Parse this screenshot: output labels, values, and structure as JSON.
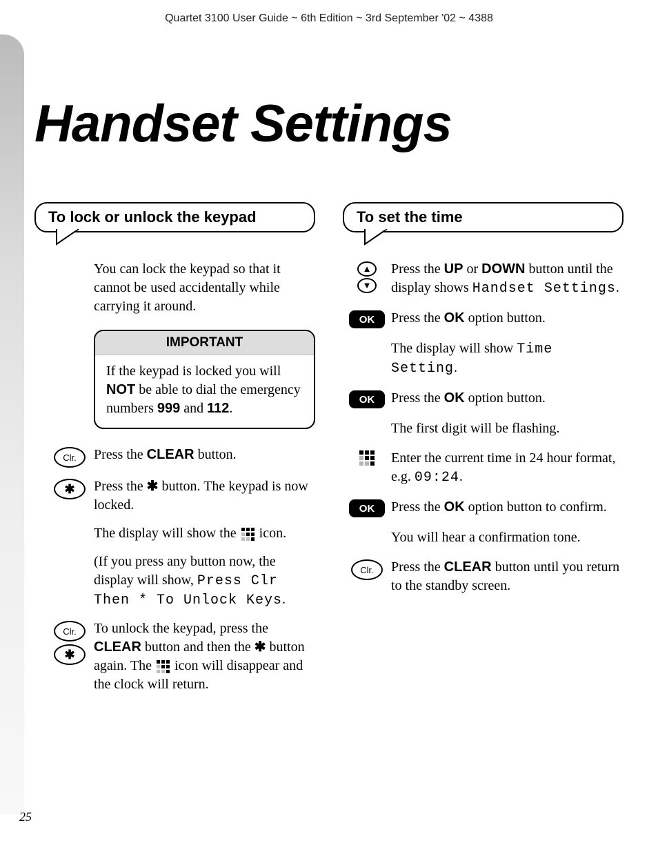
{
  "header": "Quartet 3100 User Guide ~ 6th Edition ~ 3rd September '02 ~ 4388",
  "title": "Handset Settings",
  "page_number": "25",
  "left": {
    "section_title": "To lock or unlock the keypad",
    "intro": "You can lock the keypad so that it cannot be used accidentally while carrying it around.",
    "important": {
      "label": "IMPORTANT",
      "text_before": "If the keypad is locked you will ",
      "not": "NOT",
      "text_mid": " be able to dial the emergency numbers ",
      "num1": "999",
      "and": " and ",
      "num2": "112",
      "period": "."
    },
    "step_clear": {
      "btn": "Clr.",
      "pre": "Press the ",
      "bold": "CLEAR",
      "post": " button."
    },
    "step_star": {
      "pre": "Press the ",
      "star": "✱",
      "post": " button. The keypad is now locked."
    },
    "display_show": "The display will show the ",
    "display_show_post": " icon.",
    "press_any_pre": "(If you press any button now, the display will show, ",
    "press_any_mono": "Press Clr Then * To Unlock Keys",
    "press_any_post": ".",
    "unlock_pre": "To unlock the keypad, press the ",
    "unlock_b1": "CLEAR",
    "unlock_mid": " button and then the ",
    "unlock_star": "✱",
    "unlock_mid2": " button again. The ",
    "unlock_post": " icon will disappear and the clock will return."
  },
  "right": {
    "section_title": "To set the time",
    "s1_pre": "Press the ",
    "s1_b1": "UP",
    "s1_or": " or ",
    "s1_b2": "DOWN",
    "s1_mid": " button until the display shows ",
    "s1_mono": "Handset Settings",
    "s1_post": ".",
    "ok_label": "OK",
    "s2_pre": "Press the ",
    "s2_b": "OK",
    "s2_post": " option button.",
    "s3_pre": "The display will show ",
    "s3_mono": "Time Setting",
    "s3_post": ".",
    "s4_pre": "Press the ",
    "s4_b": "OK",
    "s4_post": " option button.",
    "s5": "The first digit will be flashing.",
    "s6_pre": "Enter the current time in 24 hour format, e.g. ",
    "s6_mono": "09:24",
    "s6_post": ".",
    "s7_pre": "Press the ",
    "s7_b": "OK",
    "s7_post": " option button to confirm.",
    "s8": "You will hear a confirmation tone.",
    "clr_label": "Clr.",
    "s9_pre": "Press the ",
    "s9_b": "CLEAR",
    "s9_post": " button until you return to the standby screen."
  }
}
